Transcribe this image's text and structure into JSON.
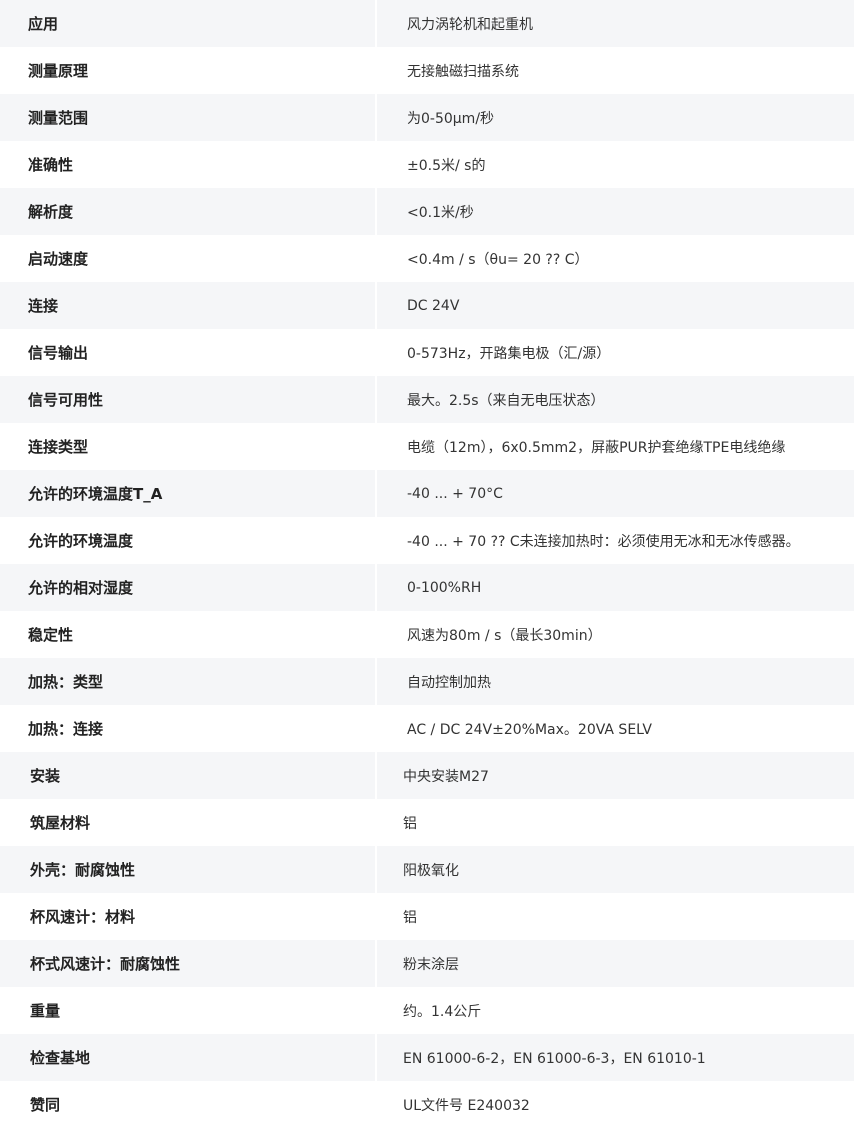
{
  "specs": {
    "rows": [
      {
        "label": "应用",
        "value": "风力涡轮机和起重机"
      },
      {
        "label": "测量原理",
        "value": "无接触磁扫描系统"
      },
      {
        "label": "测量范围",
        "value": "为0-50μm/秒"
      },
      {
        "label": "准确性",
        "value": "±0.5米/ s的"
      },
      {
        "label": "解析度",
        "value": "<0.1米/秒"
      },
      {
        "label": "启动速度",
        "value": "<0.4m / s（θu= 20 ?? C）"
      },
      {
        "label": "连接",
        "value": "DC 24V"
      },
      {
        "label": "信号输出",
        "value": "0-573Hz，开路集电极（汇/源）"
      },
      {
        "label": "信号可用性",
        "value": "最大。2.5s（来自无电压状态）"
      },
      {
        "label": "连接类型",
        "value": "电缆（12m），6x0.5mm2，屏蔽PUR护套绝缘TPE电线绝缘"
      },
      {
        "label": "允许的环境温度T_A",
        "value": "-40 ... + 70°C"
      },
      {
        "label": "允许的环境温度",
        "value": "-40 ... + 70 ?? C未连接加热时：必须使用无冰和无冰传感器。"
      },
      {
        "label": "允许的相对湿度",
        "value": "0-100%RH"
      },
      {
        "label": "稳定性",
        "value": "风速为80m / s（最长30min）"
      },
      {
        "label": "加热：类型",
        "value": "自动控制加热"
      },
      {
        "label": "加热：连接",
        "value": "AC / DC 24V±20%Max。20VA SELV"
      },
      {
        "label": "安装",
        "value": "中央安装M27"
      },
      {
        "label": "筑屋材料",
        "value": "铝"
      },
      {
        "label": "外壳：耐腐蚀性",
        "value": "阳极氧化"
      },
      {
        "label": "杯风速计：材料",
        "value": "铝"
      },
      {
        "label": "杯式风速计：耐腐蚀性",
        "value": "粉末涂层"
      },
      {
        "label": "重量",
        "value": "约。1.4公斤"
      },
      {
        "label": "检查基地",
        "value": "EN 61000-6-2，EN 61000-6-3，EN 61010-1"
      },
      {
        "label": "赞同",
        "value": "UL文件号 E240032"
      }
    ]
  }
}
